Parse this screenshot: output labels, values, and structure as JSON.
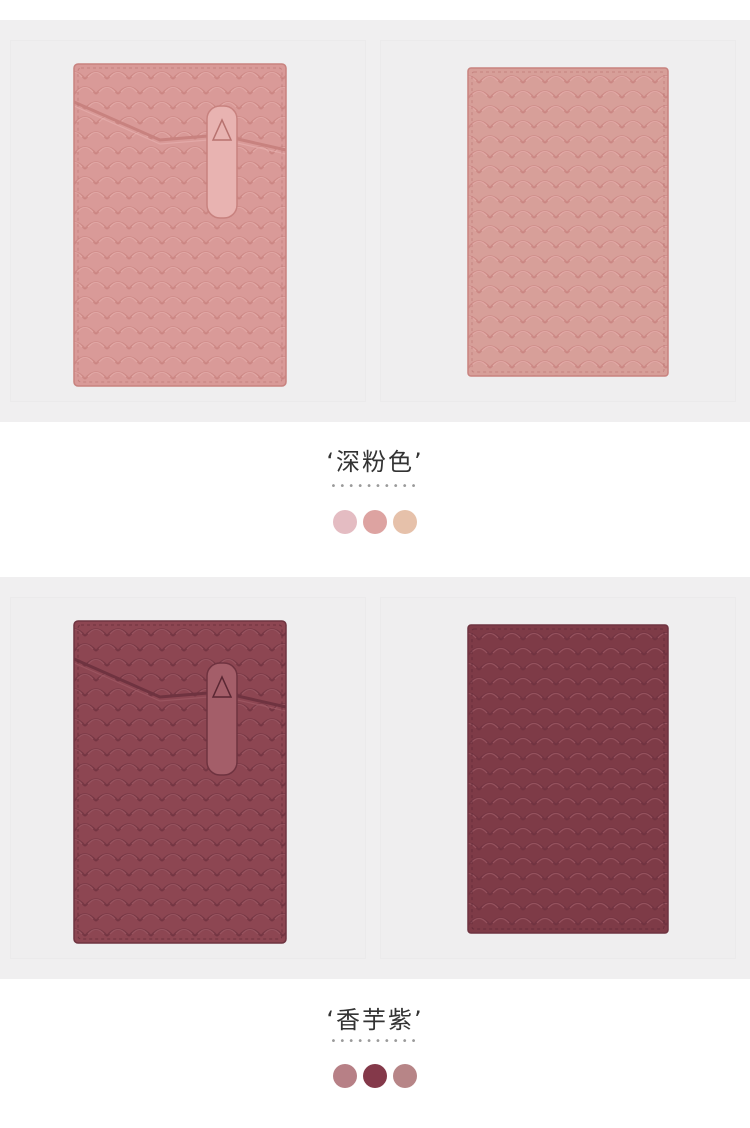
{
  "sections": [
    {
      "caption": "‘深粉色’",
      "dots": "••••••••••",
      "card_colors": {
        "base": "#d99a98",
        "dark": "#c8827f",
        "light": "#e8b3b1",
        "stitch": "#b7726f",
        "back": "#d79f99"
      },
      "swatches": [
        "#e4bcc2",
        "#dda3a1",
        "#e6c1aa"
      ],
      "front_icon": "wallet-front-pink",
      "back_icon": "wallet-back-pink"
    },
    {
      "caption": "‘香芋紫’",
      "dots": "••••••••••",
      "card_colors": {
        "base": "#8d4652",
        "dark": "#6f3340",
        "light": "#a45e69",
        "stitch": "#5a2733",
        "back": "#7e3b47"
      },
      "swatches": [
        "#b78086",
        "#84394a",
        "#b78587"
      ],
      "front_icon": "wallet-front-taro",
      "back_icon": "wallet-back-taro"
    }
  ]
}
